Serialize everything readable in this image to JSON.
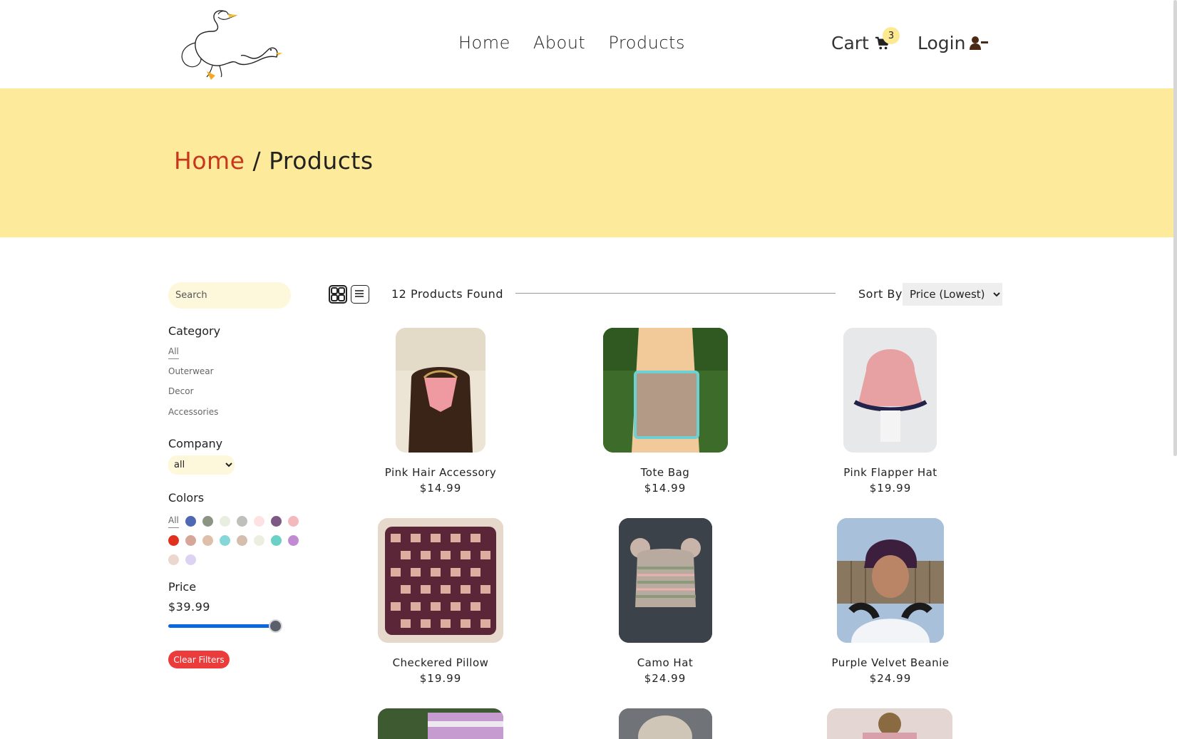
{
  "nav": {
    "home": "Home",
    "about": "About",
    "products": "Products"
  },
  "header": {
    "cart_label": "Cart",
    "cart_count": "3",
    "login_label": "Login"
  },
  "breadcrumb": {
    "home": "Home",
    "separator": "/",
    "current": "Products"
  },
  "sidebar": {
    "search_placeholder": "Search",
    "category_title": "Category",
    "categories": [
      "All",
      "Outerwear",
      "Decor",
      "Accessories"
    ],
    "company_title": "Company",
    "company_selected": "all",
    "colors_title": "Colors",
    "colors_all": "All",
    "colors": [
      "#4f68b4",
      "#8c9486",
      "#e8efe1",
      "#bfbfbb",
      "#fde2e4",
      "#7d5a86",
      "#f4b9bd",
      "#e0311e",
      "#d6a69a",
      "#dfbfa9",
      "#86d8d8",
      "#d5beae",
      "#ecefe0",
      "#6bd1c6",
      "#c08bd2",
      "#ecd7cf",
      "#ddd2f2"
    ],
    "price_title": "Price",
    "price_value": "$39.99",
    "price_level_percent": 100,
    "clear_button": "Clear Filters"
  },
  "toolbar": {
    "products_found": "12 Products Found",
    "sort_label": "Sort By",
    "sort_selected": "Price (Lowest)"
  },
  "products": [
    {
      "name": "Pink Hair Accessory",
      "price": "$14.99"
    },
    {
      "name": "Tote Bag",
      "price": "$14.99"
    },
    {
      "name": "Pink Flapper Hat",
      "price": "$19.99"
    },
    {
      "name": "Checkered Pillow",
      "price": "$19.99"
    },
    {
      "name": "Camo Hat",
      "price": "$24.99"
    },
    {
      "name": "Purple Velvet Beanie",
      "price": "$24.99"
    }
  ],
  "theme": {
    "hero_bg": "#fdeb9b",
    "accent_red": "#c9361e",
    "clear_red": "#ec3b3b",
    "slider_blue": "#0b67e0"
  }
}
